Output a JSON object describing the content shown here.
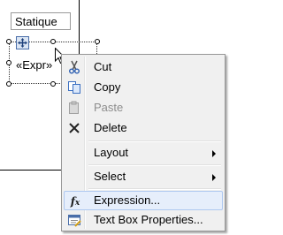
{
  "report": {
    "static_textbox": "Statique",
    "expr_textbox": "«Expr»"
  },
  "menu": {
    "items": [
      {
        "label": "Cut",
        "icon": "cut-icon",
        "enabled": true
      },
      {
        "label": "Copy",
        "icon": "copy-icon",
        "enabled": true
      },
      {
        "label": "Paste",
        "icon": "paste-icon",
        "enabled": false
      },
      {
        "label": "Delete",
        "icon": "delete-icon",
        "enabled": true
      },
      {
        "label": "Layout",
        "icon": "",
        "enabled": true,
        "submenu": true
      },
      {
        "label": "Select",
        "icon": "",
        "enabled": true,
        "submenu": true
      },
      {
        "label": "Expression...",
        "icon": "function-icon",
        "enabled": true,
        "highlighted": true
      },
      {
        "label": "Text Box Properties...",
        "icon": "properties-icon",
        "enabled": true
      }
    ]
  },
  "colors": {
    "menu_bg": "#f0f0f0",
    "highlight_bg": "#e6eefb",
    "highlight_border": "#aec8f0",
    "disabled_text": "#8d8d8d"
  }
}
